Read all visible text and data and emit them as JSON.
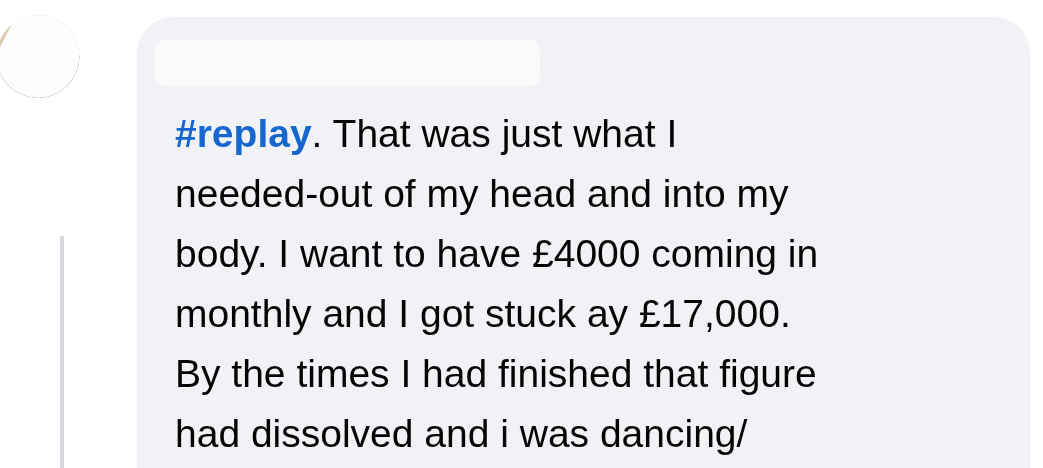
{
  "comment": {
    "hashtag": "#replay",
    "lines": [
      ". That was just what I",
      "needed-out of my head and into my",
      "body. I want to have £4000 coming in",
      "monthly and I got stuck ay £17,000.",
      "By the times I had finished that figure",
      "had dissolved and i was dancing/"
    ]
  }
}
